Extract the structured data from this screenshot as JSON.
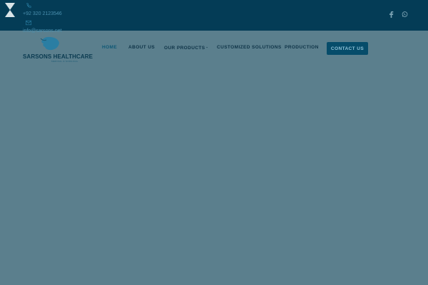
{
  "topbar": {
    "phone": "+92 320 2123546",
    "email": "info@sarsons.net",
    "social": [
      "facebook-icon",
      "whatsapp-icon"
    ]
  },
  "brand": {
    "name": "SARSONS HEALTHCARE",
    "tagline": "MEDICAL & SURGICAL"
  },
  "nav": {
    "home": "HOME",
    "about": "ABOUT US",
    "products": "OUR PRODUCTS",
    "customized": "CUSTOMIZED SOLUTIONS",
    "production": "PRODUCTION",
    "contact": "CONTACT US"
  },
  "colors": {
    "overlay": "#5b7f8d",
    "topbar": "#043c56",
    "accent": "#064c6a"
  }
}
